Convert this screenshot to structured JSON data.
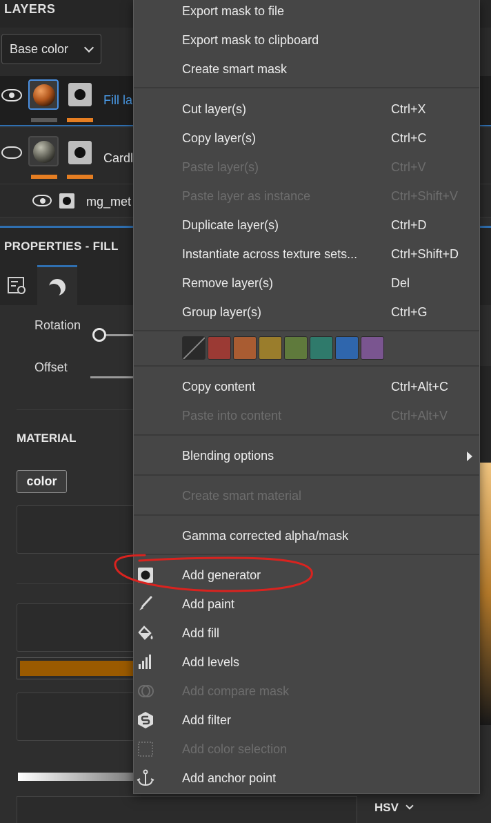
{
  "layers": {
    "title": "LAYERS",
    "channel_select": "Base color",
    "rows": [
      {
        "name": "Fill la",
        "visible": true,
        "selected": true
      },
      {
        "name": "Cardl",
        "visible": false,
        "selected": false
      },
      {
        "name": "mg_met",
        "visible": true,
        "selected": false
      }
    ]
  },
  "properties": {
    "title": "PROPERTIES - FILL",
    "rotation_label": "Rotation",
    "offset_label": "Offset",
    "material_title": "MATERIAL",
    "color_chip": "color",
    "hsv_label": "HSV"
  },
  "context_menu": {
    "items_top": [
      {
        "label": "Export mask to file",
        "shortcut": "",
        "disabled": false
      },
      {
        "label": "Export mask to clipboard",
        "shortcut": "",
        "disabled": false
      },
      {
        "label": "Create smart mask",
        "shortcut": "",
        "disabled": false
      }
    ],
    "items_edit": [
      {
        "label": "Cut layer(s)",
        "shortcut": "Ctrl+X",
        "disabled": false
      },
      {
        "label": "Copy layer(s)",
        "shortcut": "Ctrl+C",
        "disabled": false
      },
      {
        "label": "Paste layer(s)",
        "shortcut": "Ctrl+V",
        "disabled": true
      },
      {
        "label": "Paste layer as instance",
        "shortcut": "Ctrl+Shift+V",
        "disabled": true
      },
      {
        "label": "Duplicate layer(s)",
        "shortcut": "Ctrl+D",
        "disabled": false
      },
      {
        "label": "Instantiate across texture sets...",
        "shortcut": "Ctrl+Shift+D",
        "disabled": false
      },
      {
        "label": "Remove layer(s)",
        "shortcut": "Del",
        "disabled": false
      },
      {
        "label": "Group layer(s)",
        "shortcut": "Ctrl+G",
        "disabled": false
      }
    ],
    "swatch_colors": [
      "none",
      "#9b3a34",
      "#a95c32",
      "#9a7d2c",
      "#5f7a3c",
      "#2f7a6b",
      "#2f66ad",
      "#7a5590"
    ],
    "items_content": [
      {
        "label": "Copy content",
        "shortcut": "Ctrl+Alt+C",
        "disabled": false
      },
      {
        "label": "Paste into content",
        "shortcut": "Ctrl+Alt+V",
        "disabled": true
      }
    ],
    "blending": {
      "label": "Blending options"
    },
    "smart_material": {
      "label": "Create smart material",
      "disabled": true
    },
    "gamma": {
      "label": "Gamma corrected alpha/mask"
    },
    "items_add": [
      {
        "label": "Add generator",
        "icon": "generator-icon",
        "disabled": false
      },
      {
        "label": "Add paint",
        "icon": "paint-brush-icon",
        "disabled": false
      },
      {
        "label": "Add fill",
        "icon": "fill-bucket-icon",
        "disabled": false
      },
      {
        "label": "Add levels",
        "icon": "levels-icon",
        "disabled": false
      },
      {
        "label": "Add compare mask",
        "icon": "compare-mask-icon",
        "disabled": true
      },
      {
        "label": "Add filter",
        "icon": "filter-icon",
        "disabled": false
      },
      {
        "label": "Add color selection",
        "icon": "color-selection-icon",
        "disabled": true
      },
      {
        "label": "Add anchor point",
        "icon": "anchor-icon",
        "disabled": false
      }
    ]
  },
  "colors": {
    "accent": "#2f6fb0",
    "annotation_red": "#d9231f",
    "color_bar": "#9a5a00"
  }
}
